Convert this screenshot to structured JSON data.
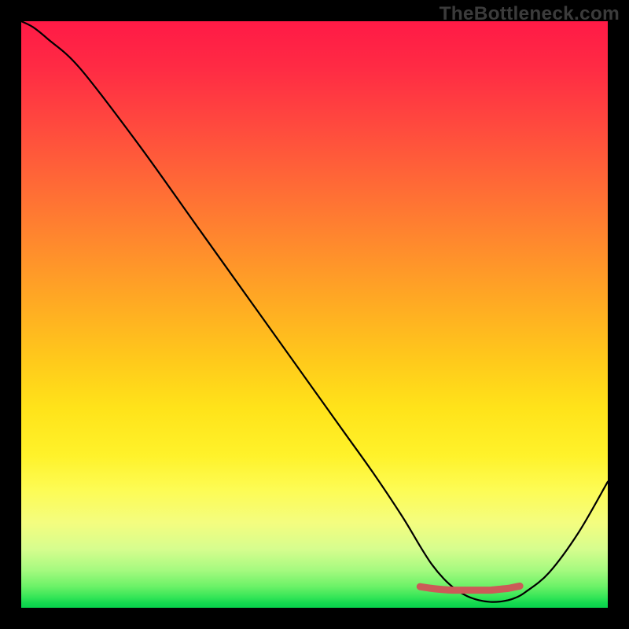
{
  "watermark": "TheBottleneck.com",
  "chart_data": {
    "type": "line",
    "title": "",
    "xlabel": "",
    "ylabel": "",
    "xlim": [
      0,
      100
    ],
    "ylim": [
      0,
      100
    ],
    "grid": false,
    "series": [
      {
        "name": "bottleneck-curve",
        "x": [
          0,
          2,
          4.5,
          10,
          20,
          30,
          40,
          50,
          55,
          60,
          65,
          68,
          70,
          72,
          74,
          76,
          78,
          80,
          82,
          84,
          86,
          90,
          95,
          100
        ],
        "values": [
          100,
          99,
          97,
          92,
          79,
          65,
          51,
          37,
          30,
          23,
          15.5,
          10.5,
          7.4,
          5,
          3.2,
          2,
          1.3,
          1,
          1.1,
          1.6,
          2.7,
          6,
          12.8,
          21.5
        ]
      },
      {
        "name": "flat-band",
        "x": [
          68,
          70,
          72,
          73.5,
          75,
          76,
          77,
          78,
          79,
          80,
          81,
          82,
          83,
          84,
          85
        ],
        "values": [
          3.6,
          3.3,
          3.1,
          3.0,
          3.0,
          3.0,
          3.0,
          3.0,
          3.0,
          3.0,
          3.1,
          3.2,
          3.3,
          3.5,
          3.7
        ]
      }
    ],
    "annotations": [
      {
        "text": "TheBottleneck.com",
        "role": "watermark",
        "position": "top-right"
      }
    ],
    "colors": {
      "curve": "#000000",
      "flat_band": "#cb5b58",
      "gradient_top": "#ff1a46",
      "gradient_mid": "#ffd21a",
      "gradient_bottom": "#08d24c",
      "background": "#000000"
    }
  }
}
